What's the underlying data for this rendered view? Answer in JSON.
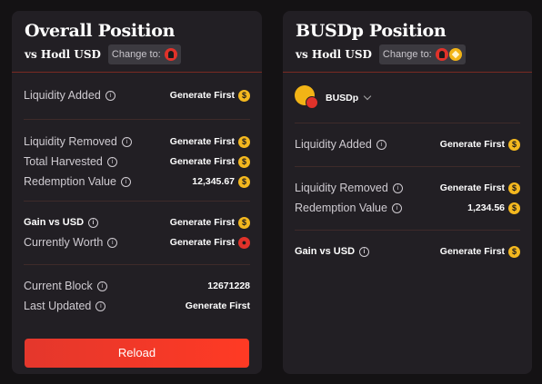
{
  "overall": {
    "title": "Overall Position",
    "vs_label": "vs Hodl USD",
    "change_to": "Change to:",
    "rows": {
      "liquidity_added": {
        "label": "Liquidity Added",
        "value": "Generate First"
      },
      "liquidity_removed": {
        "label": "Liquidity Removed",
        "value": "Generate First"
      },
      "total_harvested": {
        "label": "Total Harvested",
        "value": "Generate First"
      },
      "redemption_value": {
        "label": "Redemption Value",
        "value": "12,345.67"
      },
      "gain_vs_usd": {
        "label": "Gain vs USD",
        "value": "Generate First"
      },
      "currently_worth": {
        "label": "Currently Worth",
        "value": "Generate First"
      },
      "current_block": {
        "label": "Current Block",
        "value": "12671228"
      },
      "last_updated": {
        "label": "Last Updated",
        "value": "Generate First"
      }
    },
    "reload": "Reload"
  },
  "busd": {
    "title": "BUSDp Position",
    "vs_label": "vs Hodl USD",
    "change_to": "Change to:",
    "token": "BUSDp",
    "rows": {
      "liquidity_added": {
        "label": "Liquidity Added",
        "value": "Generate First"
      },
      "liquidity_removed": {
        "label": "Liquidity Removed",
        "value": "Generate First"
      },
      "redemption_value": {
        "label": "Redemption Value",
        "value": "1,234.56"
      },
      "gain_vs_usd": {
        "label": "Gain vs USD",
        "value": "Generate First"
      }
    }
  },
  "colors": {
    "accent": "#f4b81f",
    "reload": "#ff3a24",
    "card": "#221f24",
    "background": "#141214"
  },
  "icons": {
    "info": "info-icon",
    "usd_coin": "usd-coin-icon",
    "token": "token-icon"
  }
}
